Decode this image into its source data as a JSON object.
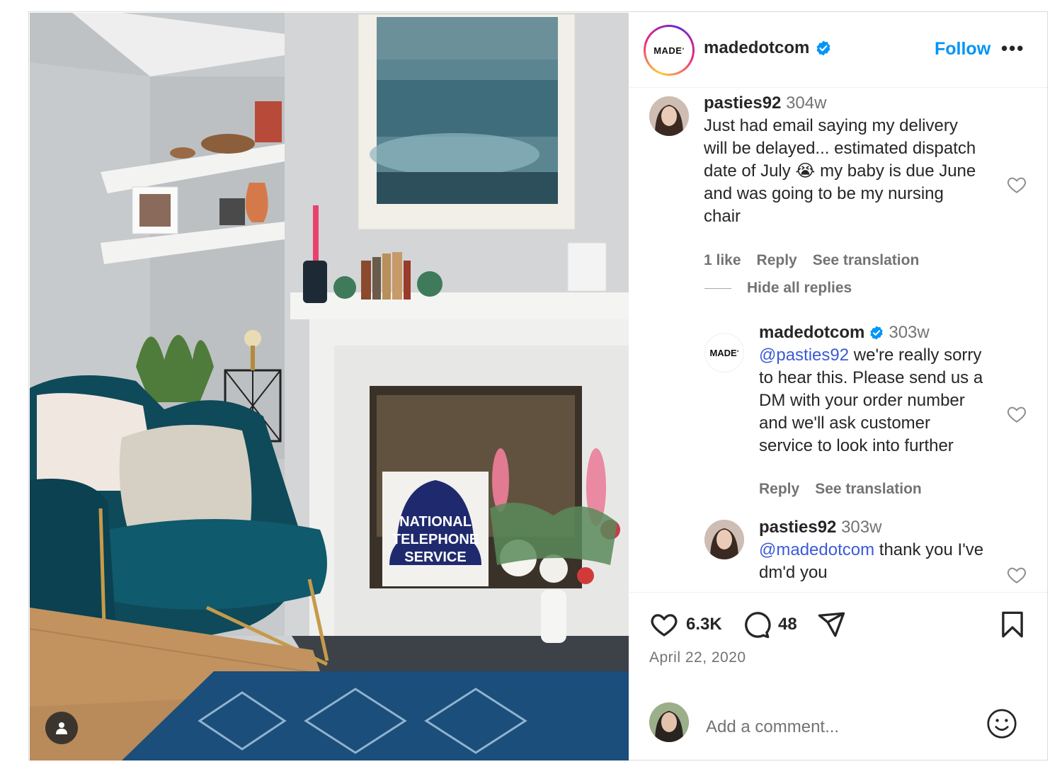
{
  "post": {
    "account": "madedotcom",
    "logo_text": "MADE",
    "follow_label": "Follow",
    "more_label": "•••",
    "likes": "6.3K",
    "comments_count": "48",
    "date": "April 22, 2020",
    "add_comment_placeholder": "Add a comment...",
    "photo_sign_lines": [
      "NATIONAL",
      "TELEPHONE",
      "SERVICE"
    ]
  },
  "comments": [
    {
      "username": "pasties92",
      "time": "304w",
      "lines": [
        "Just had email saying my delivery",
        "will be delayed... estimated dispatch",
        "date of July 😭 my baby is due June",
        "and was going to be my nursing",
        "chair"
      ],
      "likes_label": "1 like",
      "reply_label": "Reply",
      "translation_label": "See translation"
    }
  ],
  "hide_replies_label": "Hide all replies",
  "replies": [
    {
      "username": "madedotcom",
      "time": "303w",
      "mention": "@pasties92",
      "line1_rest": " we're really sorry",
      "lines": [
        "to hear this. Please send us a",
        "DM with your order number",
        "and we'll ask customer",
        "service to look into further"
      ],
      "reply_label": "Reply",
      "translation_label": "See translation"
    },
    {
      "username": "pasties92",
      "time": "303w",
      "mention": "@madedotcom",
      "line1_rest": " thank you I've",
      "lines": [
        "dm'd you"
      ]
    }
  ],
  "colors": {
    "accent": "#0095f6",
    "verified": "#0095f6",
    "muted": "#737373"
  }
}
